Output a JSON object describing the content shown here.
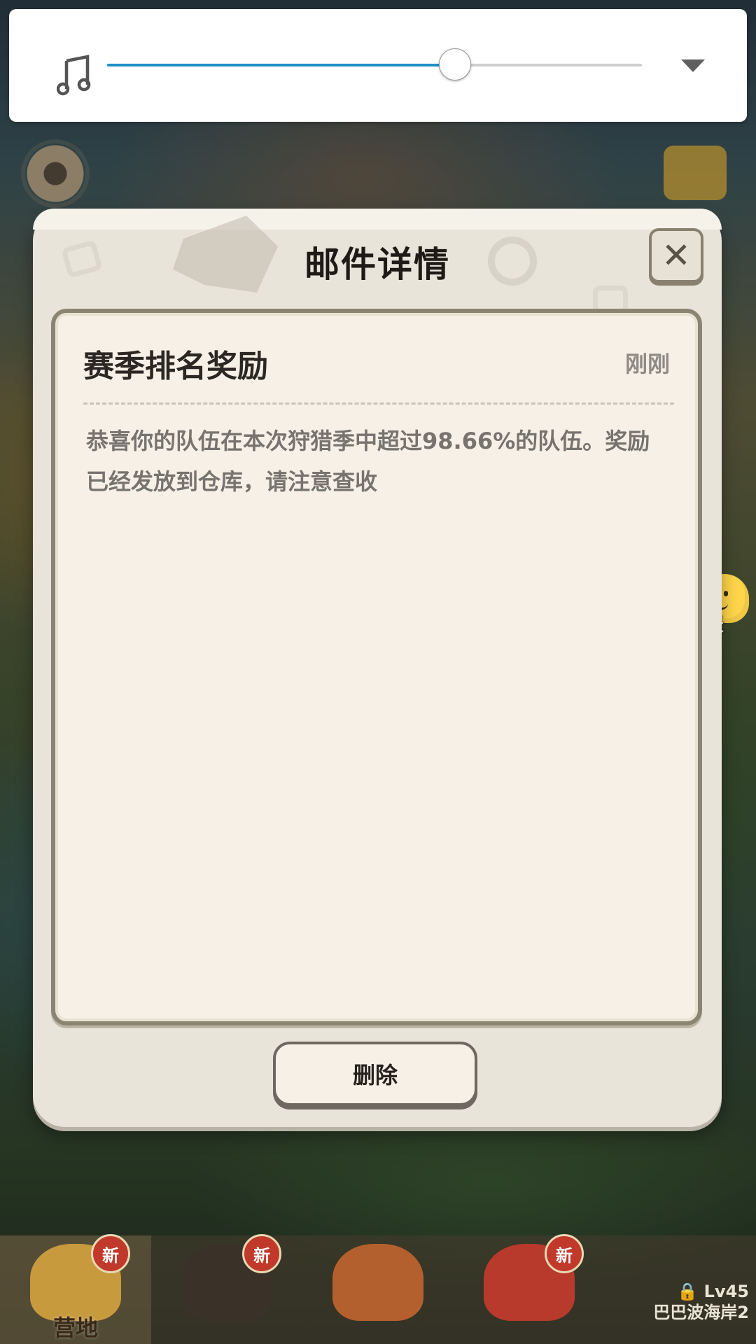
{
  "media_bar": {
    "icon": "music-note-icon",
    "volume_fraction": 0.65,
    "dropdown_icon": "chevron-down-icon",
    "accent_color": "#1f8ec6"
  },
  "dialog": {
    "title": "邮件详情",
    "close_icon": "close-icon",
    "mail": {
      "subject": "赛季排名奖励",
      "time": "刚刚",
      "body": "恭喜你的队伍在本次狩猎季中超过98.66%的队伍。奖励已经发放到仓库，请注意查收"
    },
    "delete_label": "删除"
  },
  "chat": {
    "label": "聊天"
  },
  "bottom_nav": {
    "tabs": [
      {
        "label": "营地",
        "badge": "新"
      },
      {
        "label": "",
        "badge": "新"
      },
      {
        "label": "",
        "badge": ""
      },
      {
        "label": "",
        "badge": "新"
      },
      {
        "label": "巴巴波海岸2",
        "level": "Lv45",
        "locked": true
      }
    ]
  }
}
